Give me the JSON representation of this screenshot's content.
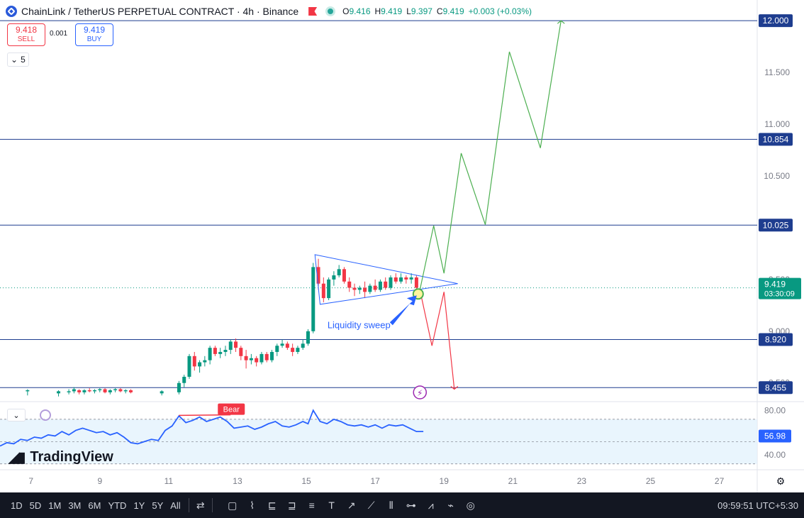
{
  "header": {
    "title": "ChainLink / TetherUS PERPETUAL CONTRACT · 4h · Binance",
    "ohlc": {
      "o_label": "O",
      "o": "9.416",
      "h_label": "H",
      "h": "9.419",
      "l_label": "L",
      "l": "9.397",
      "c_label": "C",
      "c": "9.419",
      "change": "+0.003 (+0.03%)"
    }
  },
  "trade": {
    "sell_price": "9.418",
    "sell_label": "SELL",
    "spread": "0.001",
    "buy_price": "9.419",
    "buy_label": "BUY"
  },
  "indicator_collapse_count": "5",
  "colors": {
    "bull": "#089981",
    "bear": "#f23645",
    "line": "#2962ff",
    "projection_up": "#4caf50",
    "projection_down": "#f23645",
    "hline": "#1e3d8f"
  },
  "chart_data": {
    "type": "line",
    "description_of_series": "BTC-style candlestick chart with projection paths",
    "price_axis": {
      "ticks": [
        "12.000",
        "11.500",
        "11.000",
        "10.500",
        "9.500",
        "9.000",
        "8.500"
      ],
      "ylim": [
        8.32,
        12.2
      ]
    },
    "time_axis": {
      "ticks": [
        "7",
        "9",
        "11",
        "13",
        "15",
        "17",
        "19",
        "21",
        "23",
        "25",
        "27"
      ],
      "xlim": [
        6.1,
        28.1
      ]
    },
    "horizontal_levels": [
      "12.000",
      "10.854",
      "10.025",
      "8.920",
      "8.455"
    ],
    "current_price": {
      "value": "9.419",
      "countdown": "03:30:09"
    },
    "candles": [
      {
        "t": 6.9,
        "o": 8.42,
        "h": 8.44,
        "l": 8.38,
        "c": 8.43
      },
      {
        "t": 7.8,
        "o": 8.4,
        "h": 8.43,
        "l": 8.37,
        "c": 8.42
      },
      {
        "t": 8.1,
        "o": 8.41,
        "h": 8.44,
        "l": 8.39,
        "c": 8.42
      },
      {
        "t": 8.25,
        "o": 8.42,
        "h": 8.46,
        "l": 8.4,
        "c": 8.44
      },
      {
        "t": 8.4,
        "o": 8.43,
        "h": 8.44,
        "l": 8.39,
        "c": 8.41
      },
      {
        "t": 8.55,
        "o": 8.41,
        "h": 8.44,
        "l": 8.39,
        "c": 8.43
      },
      {
        "t": 8.7,
        "o": 8.43,
        "h": 8.45,
        "l": 8.41,
        "c": 8.42
      },
      {
        "t": 8.85,
        "o": 8.42,
        "h": 8.44,
        "l": 8.4,
        "c": 8.43
      },
      {
        "t": 9.0,
        "o": 8.43,
        "h": 8.45,
        "l": 8.41,
        "c": 8.44
      },
      {
        "t": 9.15,
        "o": 8.44,
        "h": 8.45,
        "l": 8.4,
        "c": 8.41
      },
      {
        "t": 9.3,
        "o": 8.41,
        "h": 8.44,
        "l": 8.39,
        "c": 8.43
      },
      {
        "t": 9.45,
        "o": 8.43,
        "h": 8.45,
        "l": 8.41,
        "c": 8.44
      },
      {
        "t": 9.6,
        "o": 8.44,
        "h": 8.45,
        "l": 8.41,
        "c": 8.42
      },
      {
        "t": 9.75,
        "o": 8.42,
        "h": 8.44,
        "l": 8.4,
        "c": 8.43
      },
      {
        "t": 9.9,
        "o": 8.43,
        "h": 8.44,
        "l": 8.4,
        "c": 8.41
      },
      {
        "t": 10.8,
        "o": 8.4,
        "h": 8.43,
        "l": 8.38,
        "c": 8.42
      },
      {
        "t": 11.3,
        "o": 8.41,
        "h": 8.52,
        "l": 8.39,
        "c": 8.5
      },
      {
        "t": 11.45,
        "o": 8.5,
        "h": 8.58,
        "l": 8.46,
        "c": 8.56
      },
      {
        "t": 11.6,
        "o": 8.56,
        "h": 8.78,
        "l": 8.54,
        "c": 8.76
      },
      {
        "t": 11.75,
        "o": 8.76,
        "h": 8.8,
        "l": 8.62,
        "c": 8.66
      },
      {
        "t": 11.9,
        "o": 8.66,
        "h": 8.72,
        "l": 8.6,
        "c": 8.7
      },
      {
        "t": 12.05,
        "o": 8.7,
        "h": 8.76,
        "l": 8.66,
        "c": 8.72
      },
      {
        "t": 12.2,
        "o": 8.72,
        "h": 8.86,
        "l": 8.68,
        "c": 8.84
      },
      {
        "t": 12.35,
        "o": 8.84,
        "h": 8.86,
        "l": 8.76,
        "c": 8.78
      },
      {
        "t": 12.5,
        "o": 8.78,
        "h": 8.84,
        "l": 8.74,
        "c": 8.8
      },
      {
        "t": 12.65,
        "o": 8.8,
        "h": 8.86,
        "l": 8.76,
        "c": 8.82
      },
      {
        "t": 12.8,
        "o": 8.82,
        "h": 8.92,
        "l": 8.78,
        "c": 8.9
      },
      {
        "t": 12.95,
        "o": 8.9,
        "h": 8.93,
        "l": 8.8,
        "c": 8.84
      },
      {
        "t": 13.1,
        "o": 8.84,
        "h": 8.86,
        "l": 8.72,
        "c": 8.76
      },
      {
        "t": 13.25,
        "o": 8.76,
        "h": 8.82,
        "l": 8.64,
        "c": 8.72
      },
      {
        "t": 13.4,
        "o": 8.72,
        "h": 8.78,
        "l": 8.68,
        "c": 8.74
      },
      {
        "t": 13.55,
        "o": 8.74,
        "h": 8.76,
        "l": 8.66,
        "c": 8.7
      },
      {
        "t": 13.7,
        "o": 8.7,
        "h": 8.8,
        "l": 8.68,
        "c": 8.78
      },
      {
        "t": 13.85,
        "o": 8.78,
        "h": 8.8,
        "l": 8.7,
        "c": 8.72
      },
      {
        "t": 14.0,
        "o": 8.72,
        "h": 8.82,
        "l": 8.7,
        "c": 8.8
      },
      {
        "t": 14.15,
        "o": 8.8,
        "h": 8.88,
        "l": 8.76,
        "c": 8.86
      },
      {
        "t": 14.3,
        "o": 8.86,
        "h": 8.92,
        "l": 8.84,
        "c": 8.88
      },
      {
        "t": 14.45,
        "o": 8.88,
        "h": 8.9,
        "l": 8.82,
        "c": 8.84
      },
      {
        "t": 14.6,
        "o": 8.84,
        "h": 8.88,
        "l": 8.76,
        "c": 8.8
      },
      {
        "t": 14.75,
        "o": 8.8,
        "h": 8.86,
        "l": 8.78,
        "c": 8.84
      },
      {
        "t": 14.9,
        "o": 8.84,
        "h": 8.92,
        "l": 8.82,
        "c": 8.88
      },
      {
        "t": 15.05,
        "o": 8.88,
        "h": 9.02,
        "l": 8.86,
        "c": 9.0
      },
      {
        "t": 15.2,
        "o": 9.0,
        "h": 9.66,
        "l": 8.98,
        "c": 9.62
      },
      {
        "t": 15.35,
        "o": 9.62,
        "h": 9.7,
        "l": 9.4,
        "c": 9.46
      },
      {
        "t": 15.5,
        "o": 9.46,
        "h": 9.52,
        "l": 9.28,
        "c": 9.32
      },
      {
        "t": 15.65,
        "o": 9.32,
        "h": 9.52,
        "l": 9.3,
        "c": 9.5
      },
      {
        "t": 15.8,
        "o": 9.5,
        "h": 9.58,
        "l": 9.44,
        "c": 9.54
      },
      {
        "t": 15.95,
        "o": 9.54,
        "h": 9.64,
        "l": 9.52,
        "c": 9.6
      },
      {
        "t": 16.1,
        "o": 9.6,
        "h": 9.62,
        "l": 9.46,
        "c": 9.48
      },
      {
        "t": 16.25,
        "o": 9.48,
        "h": 9.52,
        "l": 9.38,
        "c": 9.42
      },
      {
        "t": 16.4,
        "o": 9.42,
        "h": 9.46,
        "l": 9.34,
        "c": 9.4
      },
      {
        "t": 16.55,
        "o": 9.4,
        "h": 9.44,
        "l": 9.36,
        "c": 9.42
      },
      {
        "t": 16.7,
        "o": 9.42,
        "h": 9.48,
        "l": 9.32,
        "c": 9.38
      },
      {
        "t": 16.85,
        "o": 9.38,
        "h": 9.46,
        "l": 9.36,
        "c": 9.44
      },
      {
        "t": 17.0,
        "o": 9.44,
        "h": 9.5,
        "l": 9.38,
        "c": 9.4
      },
      {
        "t": 17.15,
        "o": 9.4,
        "h": 9.5,
        "l": 9.38,
        "c": 9.48
      },
      {
        "t": 17.3,
        "o": 9.48,
        "h": 9.52,
        "l": 9.4,
        "c": 9.42
      },
      {
        "t": 17.45,
        "o": 9.42,
        "h": 9.54,
        "l": 9.4,
        "c": 9.52
      },
      {
        "t": 17.6,
        "o": 9.52,
        "h": 9.56,
        "l": 9.46,
        "c": 9.48
      },
      {
        "t": 17.75,
        "o": 9.48,
        "h": 9.56,
        "l": 9.46,
        "c": 9.52
      },
      {
        "t": 17.9,
        "o": 9.52,
        "h": 9.54,
        "l": 9.46,
        "c": 9.5
      },
      {
        "t": 18.05,
        "o": 9.5,
        "h": 9.56,
        "l": 9.46,
        "c": 9.52
      },
      {
        "t": 18.2,
        "o": 9.52,
        "h": 9.54,
        "l": 9.4,
        "c": 9.42
      }
    ],
    "triangle": [
      [
        15.25,
        9.74
      ],
      [
        15.4,
        9.26
      ],
      [
        19.4,
        9.46
      ]
    ],
    "projection_up": [
      [
        18.3,
        9.4
      ],
      [
        18.7,
        10.02
      ],
      [
        19.0,
        9.56
      ],
      [
        19.5,
        10.72
      ],
      [
        20.2,
        10.03
      ],
      [
        20.9,
        11.7
      ],
      [
        21.8,
        10.77
      ],
      [
        22.4,
        12.0
      ]
    ],
    "projection_down": [
      [
        18.3,
        9.4
      ],
      [
        18.65,
        8.86
      ],
      [
        19.0,
        9.38
      ],
      [
        19.3,
        8.44
      ]
    ],
    "annotations": {
      "liquidity_sweep": "Liquidity sweep",
      "bear_label": "Bear",
      "sweep_point": [
        18.25,
        9.36
      ]
    },
    "oscillator": {
      "ticks": [
        "80.00",
        "40.00"
      ],
      "ylim": [
        28,
        84
      ],
      "band": [
        32,
        72
      ],
      "mid": 52,
      "current": "56.98",
      "bear_segment": [
        [
          11.3,
          75.5
        ],
        [
          12.8,
          76
        ]
      ],
      "values": [
        [
          6.1,
          48
        ],
        [
          6.3,
          51
        ],
        [
          6.5,
          50
        ],
        [
          6.7,
          54
        ],
        [
          6.9,
          53
        ],
        [
          7.1,
          56
        ],
        [
          7.3,
          55
        ],
        [
          7.5,
          58
        ],
        [
          7.7,
          57
        ],
        [
          7.9,
          61
        ],
        [
          8.1,
          58
        ],
        [
          8.3,
          62
        ],
        [
          8.5,
          64
        ],
        [
          8.7,
          62
        ],
        [
          8.9,
          60
        ],
        [
          9.1,
          61
        ],
        [
          9.3,
          58
        ],
        [
          9.5,
          60
        ],
        [
          9.7,
          56
        ],
        [
          9.9,
          51
        ],
        [
          10.1,
          50
        ],
        [
          10.3,
          52
        ],
        [
          10.5,
          54
        ],
        [
          10.7,
          53
        ],
        [
          10.9,
          62
        ],
        [
          11.1,
          66
        ],
        [
          11.3,
          75
        ],
        [
          11.5,
          69
        ],
        [
          11.7,
          71
        ],
        [
          11.9,
          74
        ],
        [
          12.1,
          70
        ],
        [
          12.3,
          72
        ],
        [
          12.5,
          74
        ],
        [
          12.7,
          70
        ],
        [
          12.9,
          64
        ],
        [
          13.1,
          65
        ],
        [
          13.3,
          66
        ],
        [
          13.5,
          63
        ],
        [
          13.7,
          65
        ],
        [
          13.9,
          68
        ],
        [
          14.1,
          70
        ],
        [
          14.3,
          66
        ],
        [
          14.5,
          65
        ],
        [
          14.7,
          67
        ],
        [
          14.9,
          70
        ],
        [
          15.05,
          68
        ],
        [
          15.2,
          80
        ],
        [
          15.4,
          70
        ],
        [
          15.6,
          68
        ],
        [
          15.8,
          72
        ],
        [
          16.0,
          70
        ],
        [
          16.2,
          67
        ],
        [
          16.4,
          66
        ],
        [
          16.6,
          67
        ],
        [
          16.8,
          65
        ],
        [
          17.0,
          67
        ],
        [
          17.2,
          64
        ],
        [
          17.4,
          67
        ],
        [
          17.6,
          66
        ],
        [
          17.8,
          67
        ],
        [
          18.0,
          64
        ],
        [
          18.2,
          61
        ],
        [
          18.4,
          61
        ]
      ]
    }
  },
  "toolbar": {
    "timeframes": [
      "1D",
      "5D",
      "1M",
      "3M",
      "6M",
      "YTD",
      "1Y",
      "5Y",
      "All"
    ],
    "clock": "09:59:51 UTC+5:30"
  },
  "branding": "TradingView"
}
